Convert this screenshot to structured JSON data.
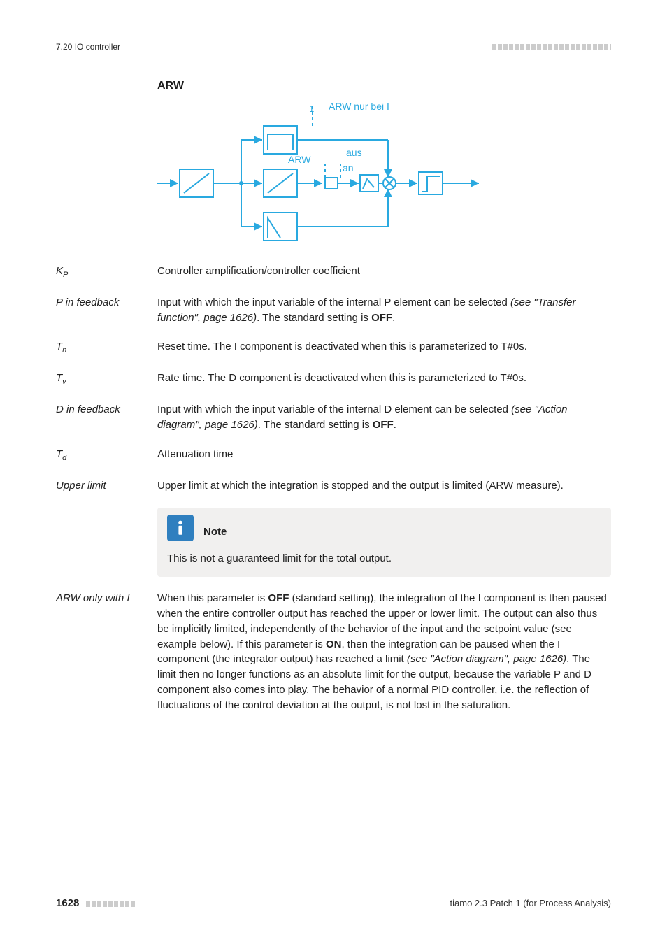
{
  "running_head": {
    "left": "7.20 IO controller"
  },
  "section": {
    "heading": "ARW"
  },
  "diagram": {
    "label_top": "ARW nur bei I",
    "label_mode": "ARW",
    "label_off": "aus",
    "label_on": "an"
  },
  "defs": {
    "kp": {
      "term_html": "K<span class='sub'>P</span>",
      "desc": "Controller amplification/controller coefficient"
    },
    "p_feedback": {
      "term": "P in feedback",
      "desc_prefix": "Input with which the input variable of the internal P element can be selected ",
      "desc_em": "(see \"Transfer function\", page 1626)",
      "desc_mid": ". The standard setting is ",
      "desc_strong": "OFF",
      "desc_suffix": "."
    },
    "tn": {
      "term_html": "T<span class='sub'>n</span>",
      "desc": "Reset time. The I component is deactivated when this is parameterized to T#0s."
    },
    "tv": {
      "term_html": "T<span class='sub'>v</span>",
      "desc": "Rate time. The D component is deactivated when this is parameterized to T#0s."
    },
    "d_feedback": {
      "term": "D in feedback",
      "desc_prefix": "Input with which the input variable of the internal D element can be selected ",
      "desc_em": "(see \"Action diagram\", page 1626)",
      "desc_mid": ". The standard setting is ",
      "desc_strong": "OFF",
      "desc_suffix": "."
    },
    "td": {
      "term_html": "T<span class='sub'>d</span>",
      "desc": "Attenuation time"
    },
    "upper_limit": {
      "term": "Upper limit",
      "desc": "Upper limit at which the integration is stopped and the output is limited (ARW measure)."
    },
    "arw_only_i": {
      "term": "ARW only with I",
      "desc_a": "When this parameter is ",
      "desc_off": "OFF",
      "desc_b": " (standard setting), the integration of the I component is then paused when the entire controller output has reached the upper or lower limit. The output can also thus be implicitly limited, independently of the behavior of the input and the setpoint value (see example below). If this parameter is ",
      "desc_on": "ON",
      "desc_c": ", then the integration can be paused when the I component (the integrator output) has reached a limit ",
      "desc_em": "(see \"Action diagram\", page 1626)",
      "desc_d": ". The limit then no longer functions as an absolute limit for the output, because the variable P and D component also comes into play. The behavior of a normal PID controller, i.e. the reflection of fluctuations of the control deviation at the output, is not lost in the saturation."
    }
  },
  "note": {
    "title": "Note",
    "body": "This is not a guaranteed limit for the total output."
  },
  "footer": {
    "page": "1628",
    "product": "tiamo 2.3 Patch 1 (for Process Analysis)"
  }
}
